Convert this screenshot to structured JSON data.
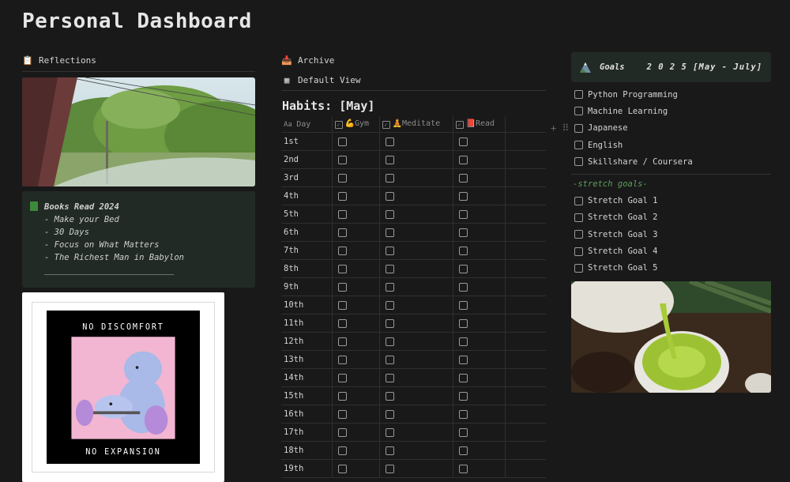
{
  "page": {
    "title": "Personal Dashboard"
  },
  "left": {
    "reflections_label": "Reflections",
    "callout": {
      "title": "Books Read 2024",
      "lines": [
        "- Make your Bed",
        "- 30 Days",
        "- Focus on What Matters",
        "- The Richest Man in Babylon",
        "__________________________"
      ]
    },
    "poster": {
      "top_text": "NO DISCOMFORT",
      "bottom_text": "NO EXPANSION"
    }
  },
  "middle": {
    "archive_label": "Archive",
    "view_label": "Default View",
    "db_title": "Habits: [May]",
    "columns": [
      "Day",
      "Gym",
      "Meditate",
      "Read"
    ],
    "rows": [
      "1st",
      "2nd",
      "3rd",
      "4th",
      "5th",
      "6th",
      "7th",
      "8th",
      "9th",
      "10th",
      "11th",
      "12th",
      "13th",
      "14th",
      "15th",
      "16th",
      "17th",
      "18th",
      "19th"
    ]
  },
  "right": {
    "goals_title": "Goals",
    "goals_period": "2 0 2 5 [May - July]",
    "goals": [
      "Python Programming",
      "Machine Learning",
      "Japanese",
      "English",
      "Skillshare / Coursera"
    ],
    "stretch_title": "-stretch goals-",
    "stretch_goals": [
      "Stretch Goal 1",
      "Stretch Goal 2",
      "Stretch Goal 3",
      "Stretch Goal 4",
      "Stretch Goal 5"
    ]
  },
  "colors": {
    "background": "#191919",
    "callout_bg": "#222a25",
    "stretch_accent": "#5f9e5f"
  }
}
